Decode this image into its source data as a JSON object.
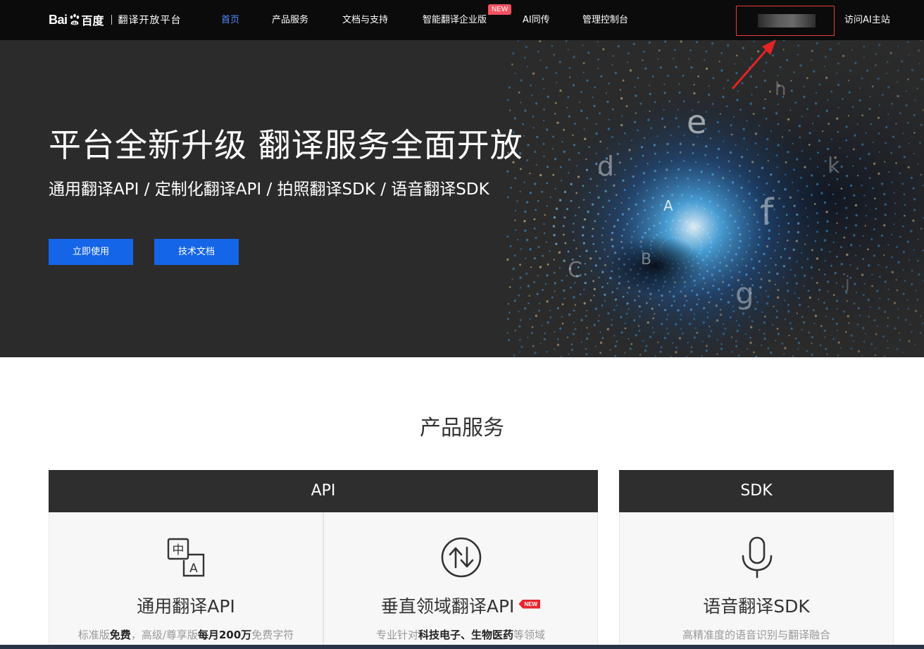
{
  "brand": {
    "logo_bai": "Bai",
    "logo_cn": "百度",
    "platform": "翻译开放平台"
  },
  "nav": {
    "items": [
      {
        "label": "首页",
        "active": true
      },
      {
        "label": "产品服务",
        "active": false
      },
      {
        "label": "文档与支持",
        "active": false
      },
      {
        "label": "智能翻译企业版",
        "active": false,
        "badge": "NEW"
      },
      {
        "label": "AI同传",
        "active": false
      },
      {
        "label": "管理控制台",
        "active": false
      }
    ],
    "visit_link": "访问AI主站"
  },
  "hero": {
    "title": "平台全新升级 翻译服务全面开放",
    "subtitle": "通用翻译API / 定制化翻译API / 拍照翻译SDK / 语音翻译SDK",
    "buttons": {
      "start": "立即使用",
      "docs": "技术文档"
    },
    "floating_letters": [
      "e",
      "h",
      "d",
      "k",
      "A",
      "f",
      "B",
      "C",
      "g",
      "j"
    ]
  },
  "products": {
    "section_title": "产品服务",
    "categories": {
      "api": "API",
      "sdk": "SDK"
    },
    "cards": [
      {
        "title": "通用翻译API",
        "icon": "translate-icon",
        "desc": [
          {
            "text": "标准版",
            "bold": false
          },
          {
            "text": "免费",
            "bold": true
          },
          {
            "text": "，高级/尊享版",
            "bold": false
          },
          {
            "text": "每月200万",
            "bold": true
          },
          {
            "text": "免费字符",
            "bold": false
          }
        ]
      },
      {
        "title": "垂直领域翻译API",
        "icon": "sync-arrows-icon",
        "badge": "NEW",
        "desc": [
          {
            "text": "专业针对",
            "bold": false
          },
          {
            "text": "科技电子、生物医药",
            "bold": true
          },
          {
            "text": "等领域",
            "bold": false
          }
        ]
      },
      {
        "title": "语音翻译SDK",
        "icon": "microphone-icon",
        "desc": [
          {
            "text": "高精准度的语音识别与翻译融合",
            "bold": false
          }
        ]
      }
    ]
  },
  "colors": {
    "nav_bg": "#0b0b0b",
    "nav_active": "#4e8cff",
    "hero_bg": "#2b2b2b",
    "primary_button": "#1565e8",
    "category_header": "#2e2e2e",
    "badge_red": "#f5515f",
    "annotation_red": "#e23b3b"
  }
}
